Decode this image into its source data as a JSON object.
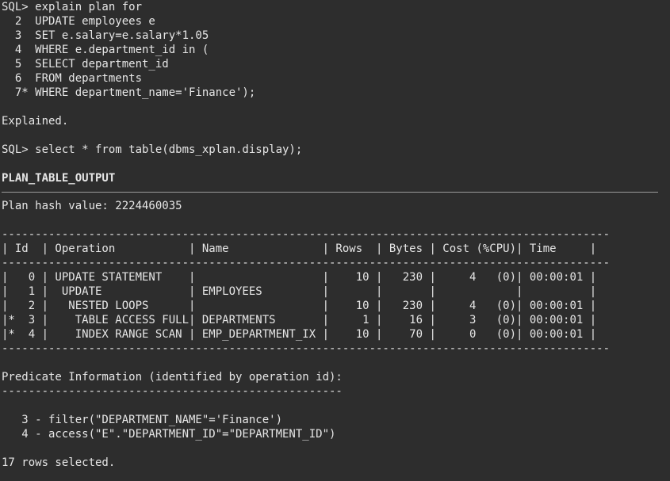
{
  "lines": [
    {
      "text": "SQL> explain plan for",
      "bold": false
    },
    {
      "text": "  2  UPDATE employees e",
      "bold": false
    },
    {
      "text": "  3  SET e.salary=e.salary*1.05",
      "bold": false
    },
    {
      "text": "  4  WHERE e.department_id in (",
      "bold": false
    },
    {
      "text": "  5  SELECT department_id",
      "bold": false
    },
    {
      "text": "  6  FROM departments",
      "bold": false
    },
    {
      "text": "  7* WHERE department_name='Finance');",
      "bold": false
    },
    {
      "text": "",
      "bold": false
    },
    {
      "text": "Explained.",
      "bold": false
    },
    {
      "text": "",
      "bold": false
    },
    {
      "text": "SQL> select * from table(dbms_xplan.display);",
      "bold": false
    },
    {
      "text": "",
      "bold": false
    },
    {
      "text": "PLAN_TABLE_OUTPUT",
      "bold": true
    },
    {
      "rule": true
    },
    {
      "text": "Plan hash value: 2224460035",
      "bold": false
    },
    {
      "text": "",
      "bold": false
    },
    {
      "text": "-------------------------------------------------------------------------------------------",
      "bold": false
    },
    {
      "text": "| Id  | Operation           | Name              | Rows  | Bytes | Cost (%CPU)| Time     |",
      "bold": false
    },
    {
      "text": "-------------------------------------------------------------------------------------------",
      "bold": false
    },
    {
      "text": "|   0 | UPDATE STATEMENT    |                   |    10 |   230 |     4   (0)| 00:00:01 |",
      "bold": false
    },
    {
      "text": "|   1 |  UPDATE             | EMPLOYEES         |       |       |            |          |",
      "bold": false
    },
    {
      "text": "|   2 |   NESTED LOOPS      |                   |    10 |   230 |     4   (0)| 00:00:01 |",
      "bold": false
    },
    {
      "text": "|*  3 |    TABLE ACCESS FULL| DEPARTMENTS       |     1 |    16 |     3   (0)| 00:00:01 |",
      "bold": false
    },
    {
      "text": "|*  4 |    INDEX RANGE SCAN | EMP_DEPARTMENT_IX |    10 |    70 |     0   (0)| 00:00:01 |",
      "bold": false
    },
    {
      "text": "-------------------------------------------------------------------------------------------",
      "bold": false
    },
    {
      "text": "",
      "bold": false
    },
    {
      "text": "Predicate Information (identified by operation id):",
      "bold": false
    },
    {
      "text": "---------------------------------------------------",
      "bold": false
    },
    {
      "text": "",
      "bold": false
    },
    {
      "text": "   3 - filter(\"DEPARTMENT_NAME\"='Finance')",
      "bold": false
    },
    {
      "text": "   4 - access(\"E\".\"DEPARTMENT_ID\"=\"DEPARTMENT_ID\")",
      "bold": false
    },
    {
      "text": "",
      "bold": false
    },
    {
      "text": "17 rows selected.",
      "bold": false
    }
  ]
}
